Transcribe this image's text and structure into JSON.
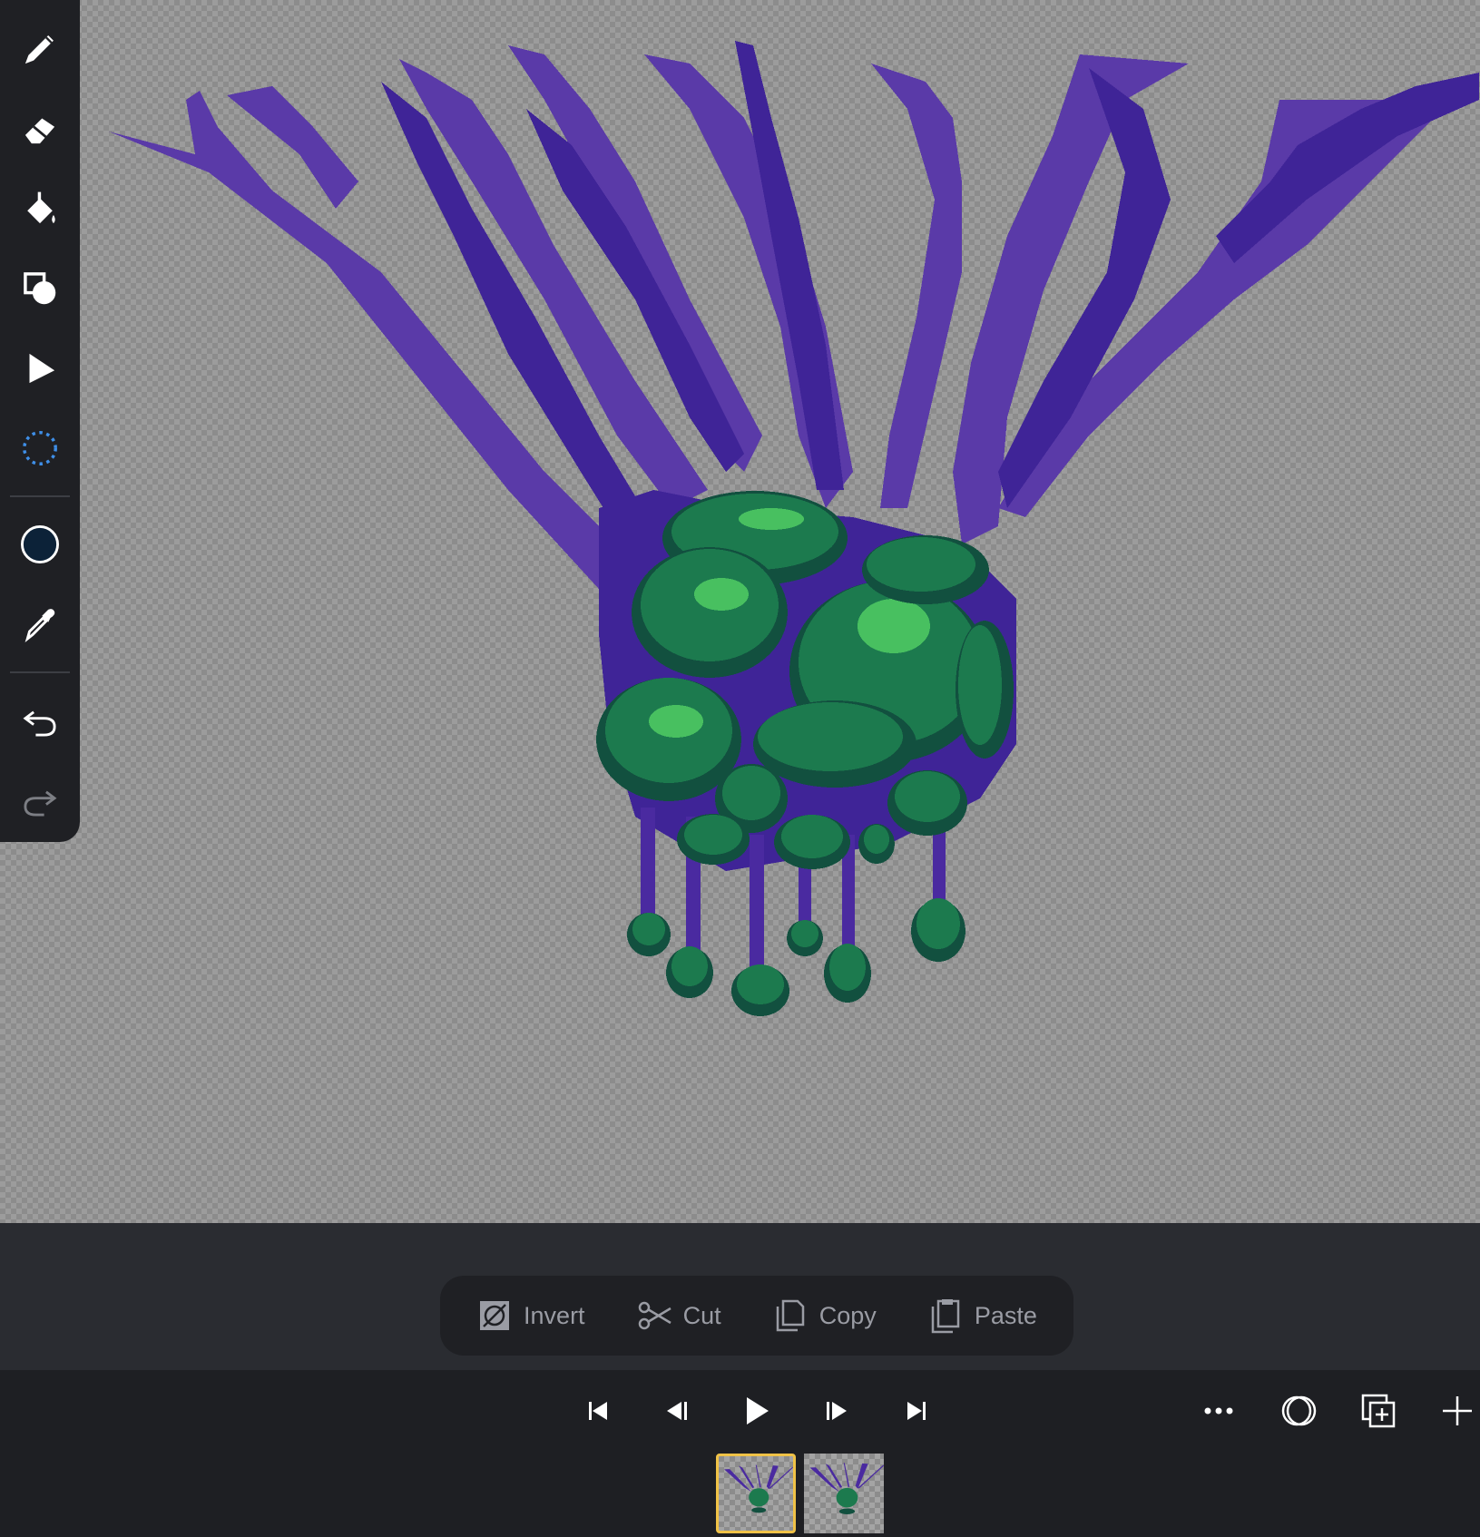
{
  "toolbar": {
    "tools": [
      "pencil-icon",
      "eraser-icon",
      "fill-bucket-icon",
      "shapes-icon",
      "move-icon",
      "lasso-select-icon"
    ],
    "active_color": "#0c2238",
    "actions": [
      "eyedropper-icon",
      "undo-icon",
      "redo-icon"
    ]
  },
  "selection_bar": {
    "invert_label": "Invert",
    "cut_label": "Cut",
    "copy_label": "Copy",
    "paste_label": "Paste"
  },
  "playback": {
    "buttons": [
      "first-frame-icon",
      "prev-frame-icon",
      "play-icon",
      "next-frame-icon",
      "last-frame-icon"
    ],
    "right_buttons": [
      "more-icon",
      "onion-skin-icon",
      "duplicate-frame-icon",
      "add-frame-icon"
    ]
  },
  "frames": {
    "count": 2,
    "active_index": 0
  },
  "colors": {
    "accent": "#f0c247",
    "vein_light": "#5a3aa8",
    "vein_dark": "#3f2497",
    "moss_dark": "#12503f",
    "moss_mid": "#1c7a4e",
    "moss_light": "#48c060"
  }
}
